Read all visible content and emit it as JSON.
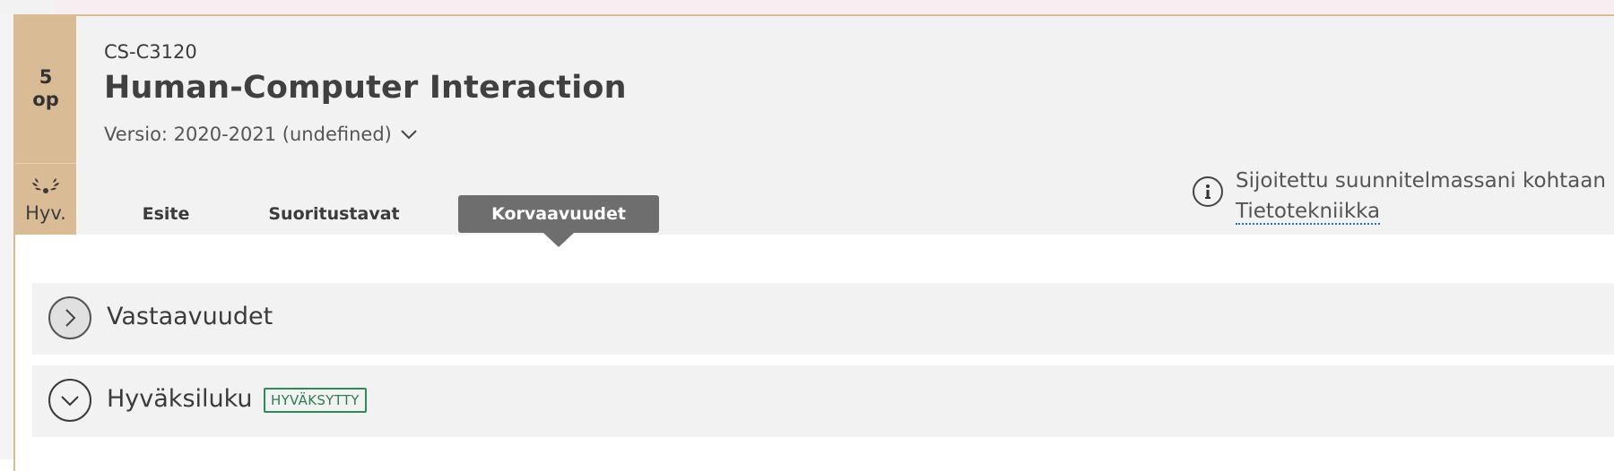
{
  "course": {
    "credits": "5\nop",
    "credits_num": "5",
    "credits_unit": "op",
    "grade": "Hyv.",
    "code": "CS-C3120",
    "title": "Human-Computer Interaction",
    "version": "Versio: 2020-2021 (undefined)"
  },
  "tabs": [
    {
      "label": "Esite",
      "active": false
    },
    {
      "label": "Suoritustavat",
      "active": false
    },
    {
      "label": "Korvaavuudet",
      "active": true
    }
  ],
  "plan": {
    "text": "Sijoitettu suunnitelmassani kohtaan",
    "link": "Tietotekniikka"
  },
  "sections": [
    {
      "title": "Vastaavuudet",
      "expanded": false,
      "icon": "chevron-right-icon"
    },
    {
      "title": "Hyväksiluku",
      "expanded": true,
      "icon": "chevron-down-icon",
      "badge": "HYVÄKSYTTY"
    }
  ],
  "colors": {
    "credit_bg": "#d9bc96",
    "active_tab": "#6e6e6e",
    "badge_green": "#2e7d4f",
    "link_underline": "#2c6fbf"
  }
}
